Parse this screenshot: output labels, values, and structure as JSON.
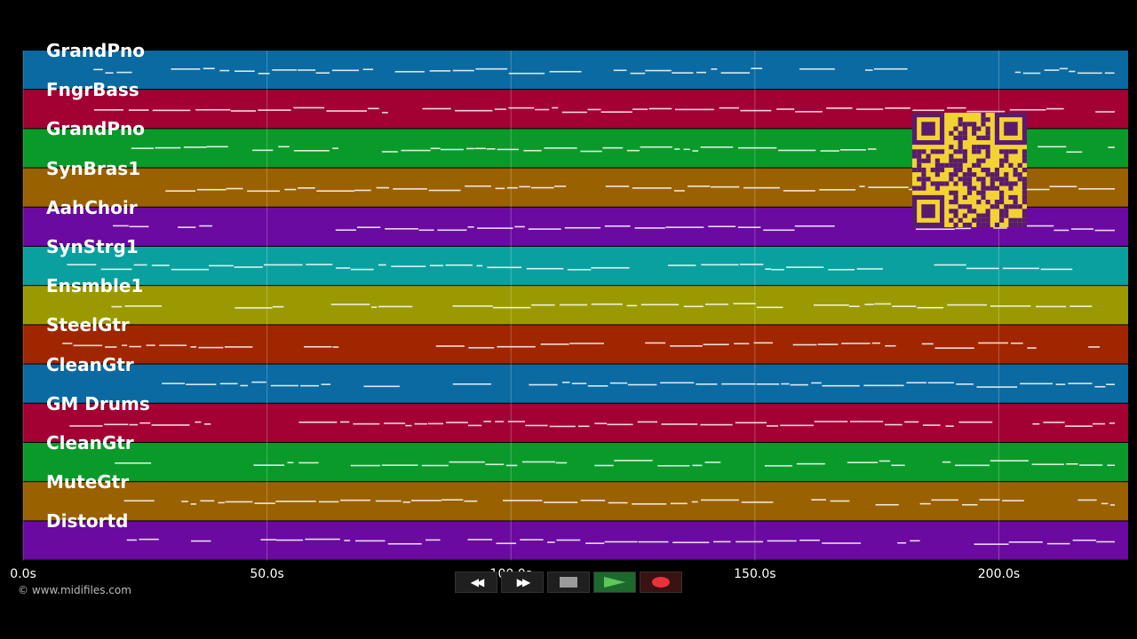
{
  "tracks": [
    {
      "name": "GrandPno",
      "color": "#0a6aa1"
    },
    {
      "name": "FngrBass",
      "color": "#a30034"
    },
    {
      "name": "GrandPno",
      "color": "#0a9a2a"
    },
    {
      "name": "SynBras1",
      "color": "#9a6100"
    },
    {
      "name": "AahChoir",
      "color": "#6a0aa0"
    },
    {
      "name": "SynStrg1",
      "color": "#0aa0a0"
    },
    {
      "name": "Ensmble1",
      "color": "#9a9a00"
    },
    {
      "name": "SteelGtr",
      "color": "#a02600"
    },
    {
      "name": "CleanGtr",
      "color": "#0a6aa1"
    },
    {
      "name": "GM Drums",
      "color": "#a30034"
    },
    {
      "name": "CleanGtr",
      "color": "#0a9a2a"
    },
    {
      "name": "MuteGtr",
      "color": "#9a6100"
    },
    {
      "name": "Distortd",
      "color": "#6a0aa0"
    }
  ],
  "timeline": {
    "min": 0,
    "max": 226.5,
    "ticks": [
      {
        "value": 0,
        "label": "0.0s"
      },
      {
        "value": 50,
        "label": "50.0s"
      },
      {
        "value": 100,
        "label": "100.0s"
      },
      {
        "value": 150,
        "label": "150.0s"
      },
      {
        "value": 200,
        "label": "200.0s"
      }
    ]
  },
  "transport": {
    "rewind_label": "◀◀",
    "forward_label": "▶▶",
    "stop_icon": "stop-icon",
    "play_icon": "play-icon",
    "record_icon": "record-icon",
    "accent_play": "#5cc85c",
    "accent_record": "#e8333a"
  },
  "footer": {
    "copyright": "© www.midifiles.com"
  }
}
